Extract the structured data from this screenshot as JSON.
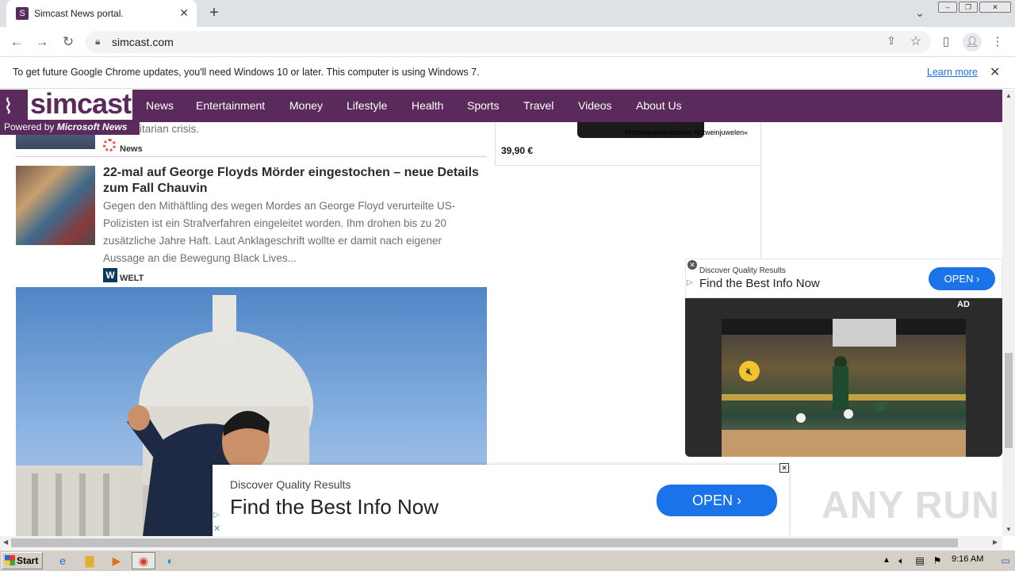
{
  "browser": {
    "tab_title": "Simcast News portal.",
    "tab_favicon": "S",
    "tab_close": "✕",
    "new_tab": "+",
    "url": "simcast.com",
    "info_message": "To get future Google Chrome updates, you'll need Windows 10 or later. This computer is using Windows 7.",
    "learn_more": "Learn more",
    "info_close": "✕"
  },
  "site": {
    "logo_text": "simcast",
    "powered_prefix": "Powered by ",
    "powered_brand": "Microsoft News",
    "nav": [
      "News",
      "Entertainment",
      "Money",
      "Lifestyle",
      "Health",
      "Sports",
      "Travel",
      "Videos",
      "About Us"
    ]
  },
  "articles": {
    "prev_tail": "itarian crisis.",
    "prev_source": "News",
    "main_title": "22-mal auf George Floyds Mörder eingestochen – neue Details zum Fall Chauvin",
    "main_desc": "Gegen den Mithäftling des wegen Mordes an George Floyd verurteilte US-Polizisten ist ein Strafverfahren eingeleitet worden. Ihm drohen bis zu 20 zusätzliche Jahre Haft. Laut Anklageschrift wollte er damit nach eigener Aussage an die Bewegung Black Lives...",
    "main_source": "WELT",
    "main_source_badge": "W"
  },
  "product_ad": {
    "caption": "Probierpaket»Italiens Rotweinjuwelen«",
    "price": "39,90 €"
  },
  "video_ad": {
    "small": "Discover Quality Results",
    "headline": "Find the Best Info Now",
    "button": "OPEN",
    "ad_label": "AD"
  },
  "banner_ad": {
    "small": "Discover Quality Results",
    "headline": "Find the Best Info Now",
    "button": "OPEN",
    "close": "✕"
  },
  "watermark": "ANY RUN",
  "taskbar": {
    "start": "Start",
    "clock": "9:16 AM"
  }
}
